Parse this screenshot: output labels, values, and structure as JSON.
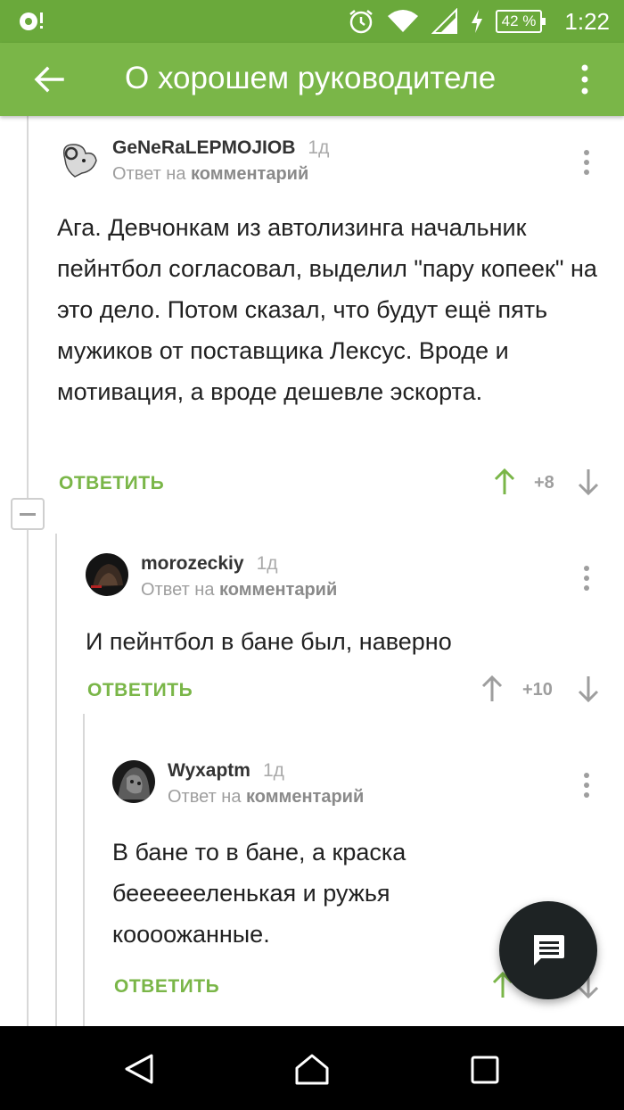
{
  "status_bar": {
    "time": "1:22",
    "battery": "42 %",
    "icons": [
      "notification-icon",
      "alarm-icon",
      "wifi-icon",
      "signal-icon",
      "charging-icon"
    ]
  },
  "app_bar": {
    "title": "О хорошем руководителе"
  },
  "comments": [
    {
      "author": "GeNeRaLEPMOJIOB",
      "age": "1д",
      "reply_prefix": "Ответ на",
      "reply_target": "комментарий",
      "text": "Ага. Девчонкам из автолизинга начальник пейнтбол согласовал, выделил \"пару копеек\" на это дело. Потом сказал, что будут ещё пять мужиков от поставщика Лексус. Вроде и мотивация, а вроде дешевле эскорта.",
      "reply_label": "ОТВЕТИТЬ",
      "score": "+8"
    },
    {
      "author": "morozeckiy",
      "age": "1д",
      "reply_prefix": "Ответ на",
      "reply_target": "комментарий",
      "text": "И пейнтбол в бане был, наверно",
      "reply_label": "ОТВЕТИТЬ",
      "score": "+10"
    },
    {
      "author": "Wyxaptm",
      "age": "1д",
      "reply_prefix": "Ответ на",
      "reply_target": "комментарий",
      "text": "В бане то в бане, а краска бееееееленькая и ружья коооожанные.",
      "reply_label": "ОТВЕТИТЬ",
      "score": ""
    }
  ],
  "colors": {
    "status_bar": "#6aa93b",
    "app_bar": "#7ab648",
    "accent": "#7ab648",
    "upvote_active": "#7ab648",
    "fab": "#1e2324"
  }
}
